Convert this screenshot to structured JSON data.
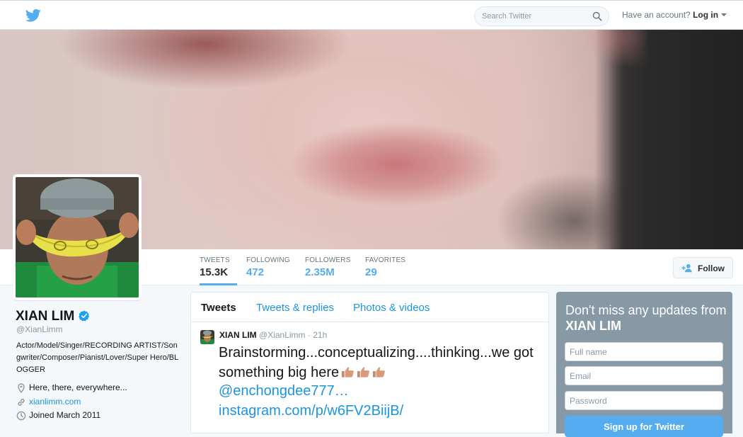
{
  "topbar": {
    "logo_icon": "twitter-bird-icon",
    "search_placeholder": "Search Twitter",
    "search_icon": "search-icon",
    "account_prompt": "Have an account?",
    "login_label": "Log in"
  },
  "profile": {
    "name": "XIAN LIM",
    "verified": true,
    "handle": "@XianLimm",
    "bio": "Actor/Model/Singer/RECORDING ARTIST/Songwriter/Composer/Pianist/Lover/Super Hero/BLOGGER",
    "location": "Here, there, everywhere...",
    "website": "xianlimm.com",
    "joined": "Joined March 2011"
  },
  "stats": [
    {
      "label": "TWEETS",
      "value": "15.3K"
    },
    {
      "label": "FOLLOWING",
      "value": "472"
    },
    {
      "label": "FOLLOWERS",
      "value": "2.35M"
    },
    {
      "label": "FAVORITES",
      "value": "29"
    }
  ],
  "follow_label": "Follow",
  "timeline": {
    "tabs": [
      "Tweets",
      "Tweets & replies",
      "Photos & videos"
    ],
    "active_tab": "Tweets",
    "tweet": {
      "name": "XIAN LIM",
      "handle": "@XianLimm",
      "time": "21h",
      "separator": "·",
      "text": "Brainstorming...conceptualizing....thinking...we got something big here",
      "emoji": "thumbs-up-icon x3",
      "mention": "@enchongdee777…",
      "link": "instagram.com/p/w6FV2BiijB/"
    }
  },
  "signup": {
    "heading_prefix": "Don't miss any updates from",
    "heading_name": "XIAN LIM",
    "full_name_placeholder": "Full name",
    "email_placeholder": "Email",
    "password_placeholder": "Password",
    "button_label": "Sign up for Twitter"
  },
  "colors": {
    "accent": "#55acee",
    "link": "#1b95e0",
    "signup_card": "#8899a6"
  }
}
